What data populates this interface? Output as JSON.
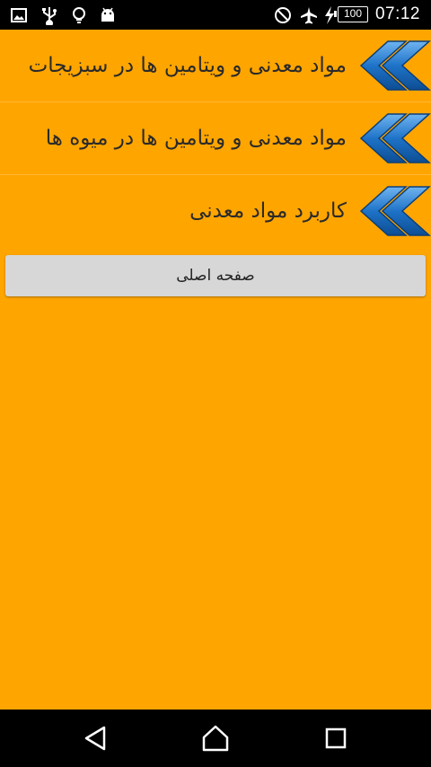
{
  "status_bar": {
    "time": "07:12",
    "battery": "100",
    "icons": [
      "image-icon",
      "usb-icon",
      "lightbulb-icon",
      "android-icon",
      "do-not-disturb-icon",
      "airplane-icon",
      "charging-icon",
      "battery-icon"
    ]
  },
  "menu": {
    "items": [
      {
        "label": "مواد معدنی و ویتامین ها در سبزیجات",
        "icon": "double-chevron-left-icon"
      },
      {
        "label": "مواد معدنی و ویتامین ها در میوه ها",
        "icon": "double-chevron-left-icon"
      },
      {
        "label": "کاربرد مواد معدنی",
        "icon": "double-chevron-left-icon"
      }
    ],
    "home_button_label": "صفحه اصلی"
  },
  "nav_bar": {
    "icons": [
      "back-icon",
      "home-icon",
      "recents-icon"
    ]
  },
  "colors": {
    "background": "#FFA500",
    "arrow_blue": "#1E73C8",
    "button_gray": "#D7D7D7"
  }
}
